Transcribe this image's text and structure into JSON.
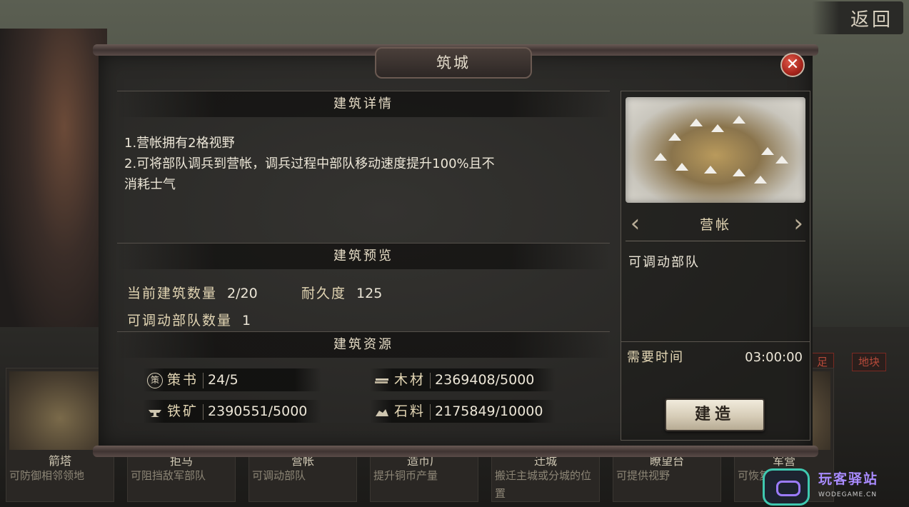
{
  "background": {
    "return_label": "返回",
    "tags": [
      "足",
      "地块"
    ],
    "cards": [
      {
        "name": "箭塔",
        "desc": "可防御相邻领地"
      },
      {
        "name": "拒马",
        "desc": "可阻挡敌军部队"
      },
      {
        "name": "营帐",
        "desc": "可调动部队"
      },
      {
        "name": "造币厂",
        "desc": "提升铜币产量"
      },
      {
        "name": "迁城",
        "desc": "搬迁主城或分城的位置"
      },
      {
        "name": "瞭望台",
        "desc": "可提供视野"
      },
      {
        "name": "军营",
        "desc": "可恢复伤兵"
      }
    ]
  },
  "watermark": {
    "name": "玩客驿站",
    "url": "WODEGAME.CN"
  },
  "dialog": {
    "title": "筑城",
    "sections": {
      "detail_title": "建筑详情",
      "detail_lines": [
        "1.营帐拥有2格视野",
        "2.可将部队调兵到营帐，调兵过程中部队移动速度提升100%且不",
        "消耗士气"
      ],
      "preview_title": "建筑预览",
      "preview": {
        "count_label": "当前建筑数量",
        "count_value": "2/20",
        "durability_label": "耐久度",
        "durability_value": "125",
        "troops_label": "可调动部队数量",
        "troops_value": "1"
      },
      "resources_title": "建筑资源",
      "resources": [
        {
          "icon": "decree-icon",
          "name": "策书",
          "value": "24/5"
        },
        {
          "icon": "wood-icon",
          "name": "木材",
          "value": "2369408/5000"
        },
        {
          "icon": "iron-icon",
          "name": "铁矿",
          "value": "2390551/5000"
        },
        {
          "icon": "stone-icon",
          "name": "石料",
          "value": "2175849/10000"
        }
      ]
    },
    "right": {
      "building_name": "营帐",
      "prev_arrow": "‹",
      "next_arrow": "›",
      "description": "可调动部队",
      "time_label": "需要时间",
      "time_value": "03:00:00",
      "build_label": "建造",
      "decree_glyph": "策"
    }
  }
}
